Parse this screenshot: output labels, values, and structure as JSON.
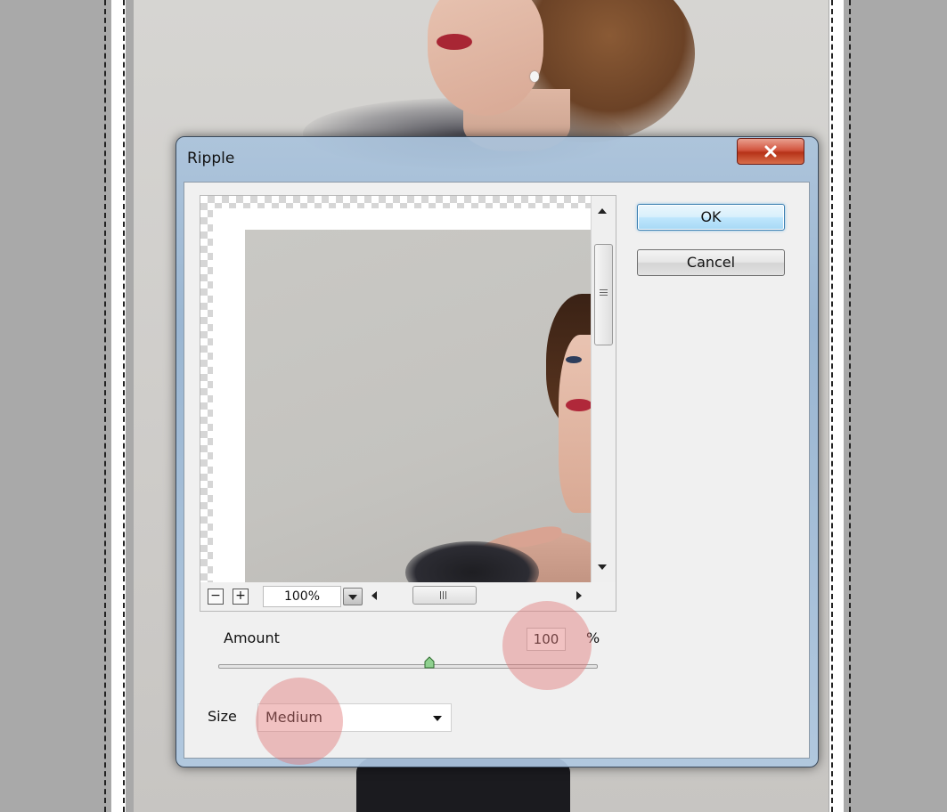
{
  "dialog": {
    "title": "Ripple",
    "ok_label": "OK",
    "cancel_label": "Cancel"
  },
  "preview": {
    "zoom_out_label": "−",
    "zoom_in_label": "+",
    "zoom_value": "100%"
  },
  "amount": {
    "label": "Amount",
    "value": "100",
    "unit": "%",
    "slider_level": 0.56
  },
  "size": {
    "label": "Size",
    "value": "Medium"
  },
  "colors": {
    "highlight": "#e07878",
    "ok_border": "#3c7fb1",
    "close_button": "#c8432a"
  },
  "icons": [
    "close-icon",
    "zoom-out-icon",
    "zoom-in-icon",
    "dropdown-arrow-icon",
    "scroll-up-arrow-icon",
    "scroll-down-arrow-icon",
    "scroll-left-arrow-icon",
    "scroll-right-arrow-icon",
    "slider-thumb-icon"
  ]
}
